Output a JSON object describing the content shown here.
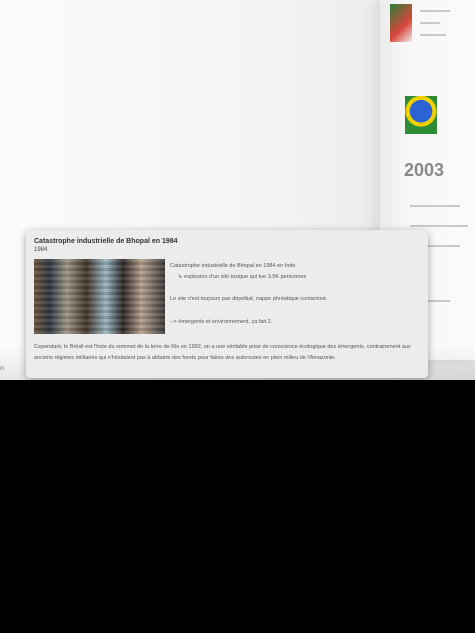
{
  "card": {
    "title": "Catastrophe industrielle de Bhopal en 1984",
    "year": "1984",
    "lines": [
      "Catastrophe industrielle de Bhopal en 1984 en Inde.",
      "↳ explosion d'un silo toxique qui tue 3.5K personnes",
      "Le site n'est toujours pas dépollué, nappe phréatique contaminé.",
      "--> émergents et environnement, ça fait 2."
    ],
    "paragraph": "Cependant, le Brésil est l'hote du sommet de la terre de Rio en 1992, on a une véritable prise de conscience écologique des émergents, contrairement aux anciens régimes militaires qui n'hésitaient pas à abbatre des forets pour faires des autoroutes en plein milieu de l'Amazonie."
  },
  "background": {
    "year_label": "2003",
    "left_label": "III"
  }
}
